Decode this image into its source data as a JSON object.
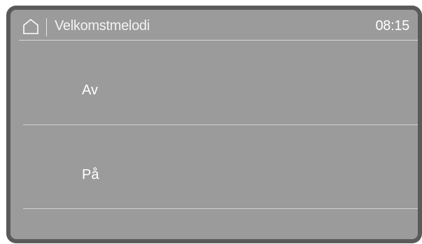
{
  "header": {
    "home_icon": "home-icon",
    "title": "Velkomstmelodi",
    "time": "08:15"
  },
  "options": [
    {
      "label": "Av"
    },
    {
      "label": "På"
    }
  ],
  "colors": {
    "screen_background": "#9b9b9b",
    "bezel": "#5a5a5a",
    "text": "#ffffff",
    "divider": "#d2d2d2"
  }
}
